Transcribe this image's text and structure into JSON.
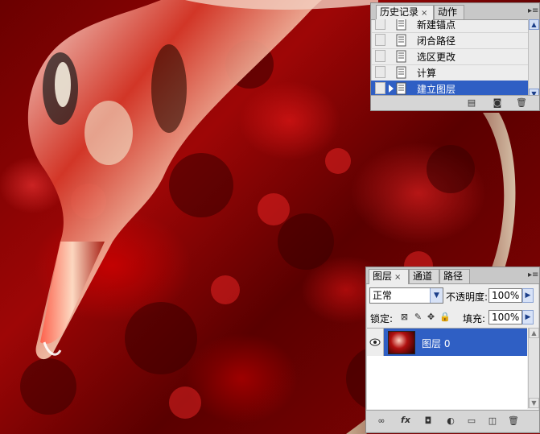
{
  "history_panel": {
    "tabs": [
      {
        "label": "历史记录",
        "close": "×"
      },
      {
        "label": "动作"
      }
    ],
    "menu_icon": "menu-icon",
    "items": [
      {
        "label": "新建锚点"
      },
      {
        "label": "闭合路径"
      },
      {
        "label": "选区更改"
      },
      {
        "label": "计算"
      },
      {
        "label": "建立图层"
      }
    ],
    "selected_index": 4,
    "footer_icons": [
      "new-document-from-state-icon",
      "camera-icon",
      "trash-icon"
    ]
  },
  "layers_panel": {
    "tabs": [
      {
        "label": "图层",
        "close": "×"
      },
      {
        "label": "通道"
      },
      {
        "label": "路径"
      }
    ],
    "blend_mode": "正常",
    "opacity_label": "不透明度:",
    "opacity_value": "100%",
    "lock_label": "锁定:",
    "fill_label": "填充:",
    "fill_value": "100%",
    "layers": [
      {
        "name": "图层 0",
        "visible": true,
        "selected": true
      }
    ],
    "footer_icons": [
      "link-icon",
      "fx-icon",
      "mask-icon",
      "adjustment-icon",
      "folder-icon",
      "new-layer-icon",
      "trash-icon"
    ],
    "fx_label": "fx"
  },
  "colors": {
    "selection": "#2f5fc4",
    "panel_bg": "#ededed",
    "canvas_red": "#9e0606"
  }
}
